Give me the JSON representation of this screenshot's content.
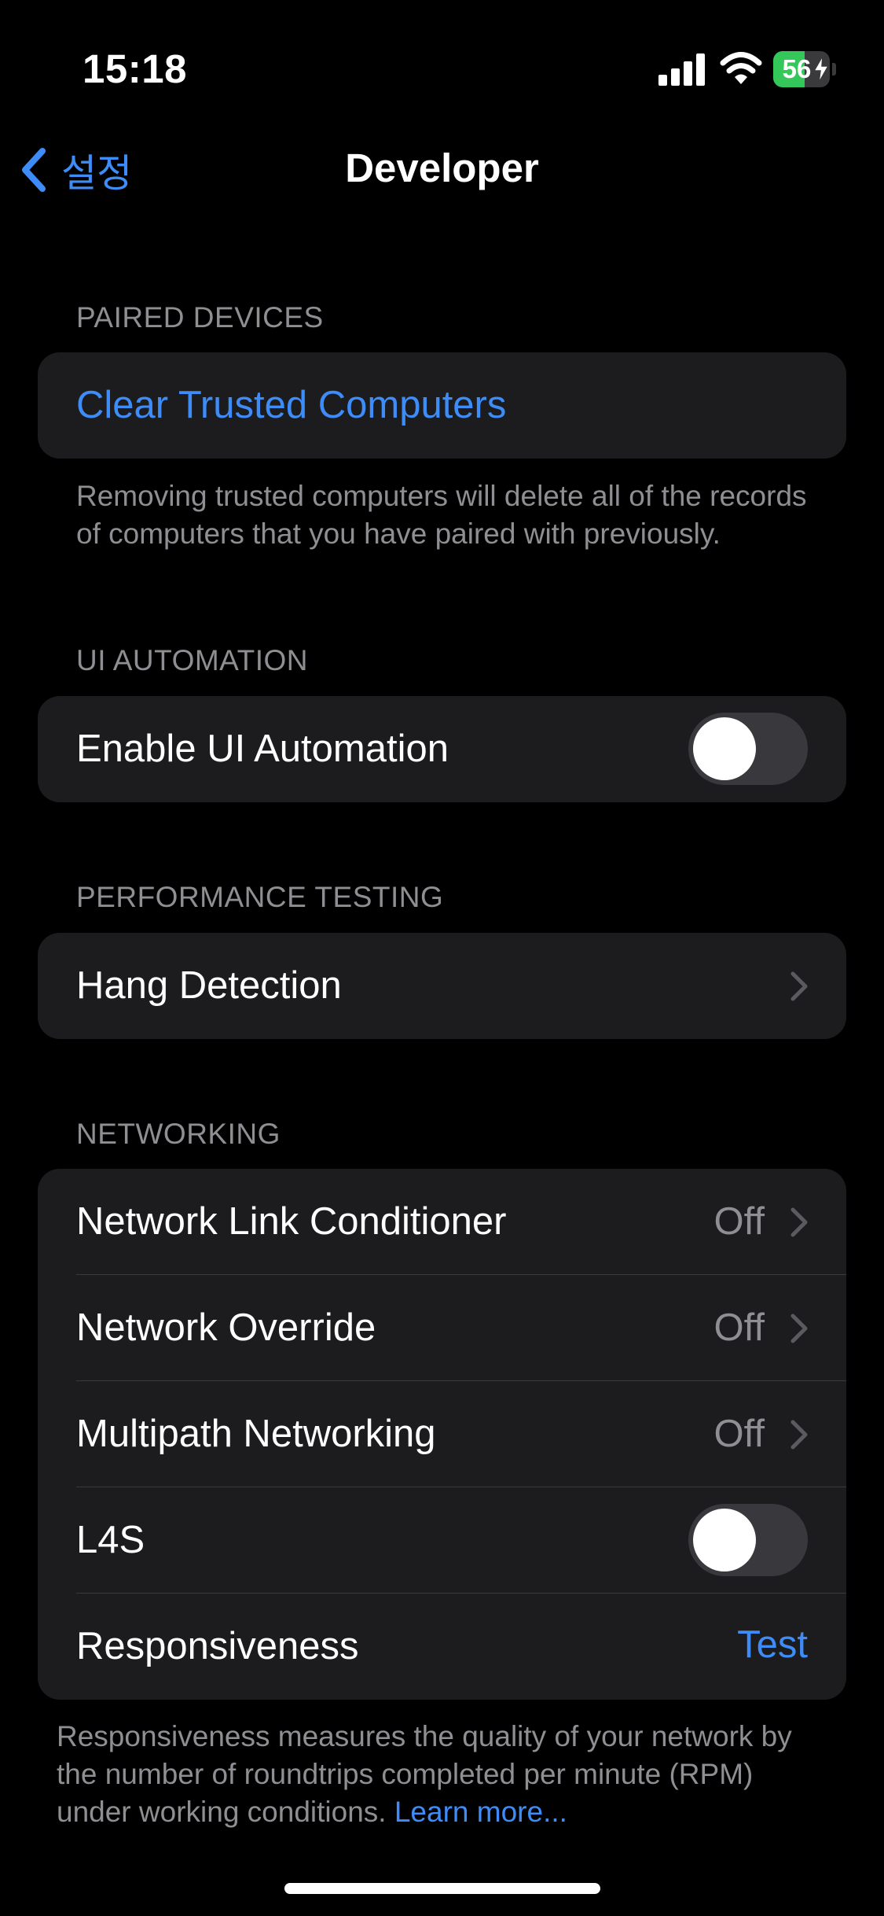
{
  "status_bar": {
    "time": "15:18",
    "battery_percent": "56",
    "battery_level": 0.56,
    "charging": true,
    "icons": [
      "signal-icon",
      "wifi-icon",
      "battery-icon",
      "charging-bolt-icon"
    ]
  },
  "nav": {
    "back_label": "설정",
    "title": "Developer",
    "back_icon": "chevron-left-icon"
  },
  "sections": {
    "paired_devices": {
      "header": "PAIRED DEVICES",
      "clear_label": "Clear Trusted Computers",
      "footer": "Removing trusted computers will delete all of the records of computers that you have paired with previously."
    },
    "ui_automation": {
      "header": "UI AUTOMATION",
      "enable_label": "Enable UI Automation",
      "enabled": false
    },
    "performance_testing": {
      "header": "PERFORMANCE TESTING",
      "hang_detection_label": "Hang Detection"
    },
    "networking": {
      "header": "NETWORKING",
      "rows": [
        {
          "label": "Network Link Conditioner",
          "value": "Off"
        },
        {
          "label": "Network Override",
          "value": "Off"
        },
        {
          "label": "Multipath Networking",
          "value": "Off"
        }
      ],
      "l4s_label": "L4S",
      "l4s_enabled": false,
      "responsiveness_label": "Responsiveness",
      "responsiveness_action": "Test",
      "footer_text": "Responsiveness measures the quality of your network by the number of roundtrips completed per minute (RPM) under working conditions.",
      "footer_link": "Learn more..."
    }
  },
  "colors": {
    "background": "#000000",
    "group": "#1c1c1e",
    "accent": "#3e8cf7",
    "secondary_text": "#8e8e93",
    "battery_green": "#34c759"
  }
}
